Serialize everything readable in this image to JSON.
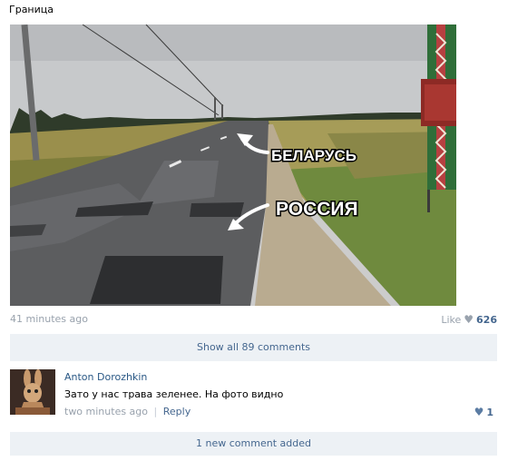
{
  "post": {
    "title": "Граница",
    "photo_labels": {
      "belarus": "БЕЛАРУСЬ",
      "russia": "РОССИЯ"
    },
    "time": "41 minutes ago",
    "like_label": "Like",
    "like_count": "626"
  },
  "comments_bar": {
    "show_all": "Show all 89 comments"
  },
  "comment": {
    "author": "Anton Dorozhkin",
    "text": "Зато у нас трава зеленее. На фото видно",
    "time": "two minutes ago",
    "separator": "|",
    "reply": "Reply",
    "likes": "1"
  },
  "new_comment_bar": {
    "label": "1 new comment added"
  },
  "icons": {
    "like": "heart-icon",
    "comment_like": "heart-icon",
    "arrow": "arrow-icon"
  },
  "colors": {
    "link": "#2a5885",
    "accent": "#45678f",
    "muted": "#99a2ad",
    "bar_bg": "#edf1f5"
  }
}
